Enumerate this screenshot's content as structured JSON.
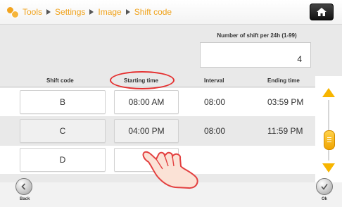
{
  "breadcrumb": {
    "items": [
      "Tools",
      "Settings",
      "Image",
      "Shift code"
    ]
  },
  "shifts_per_day": {
    "label": "Number of shift per 24h (1-99)",
    "value": "4"
  },
  "table": {
    "headers": {
      "shift_code": "Shift code",
      "starting_time": "Starting time",
      "interval": "Interval",
      "ending_time": "Ending time"
    },
    "rows": [
      {
        "code": "B",
        "start": "08:00 AM",
        "interval": "08:00",
        "end": "03:59 PM"
      },
      {
        "code": "C",
        "start": "04:00 PM",
        "interval": "08:00",
        "end": "11:59 PM"
      },
      {
        "code": "D",
        "start": "",
        "interval": "",
        "end": ""
      }
    ]
  },
  "footer": {
    "back_label": "Back",
    "ok_label": "Ok"
  },
  "icons": {
    "tools": "tools-icon",
    "home": "home-icon",
    "back": "back-arrow-icon",
    "ok": "checkmark-icon",
    "scroll_up": "triangle-up-icon",
    "scroll_down": "triangle-down-icon",
    "pointer": "hand-pointer-icon"
  },
  "colors": {
    "accent": "#f0a21a",
    "highlight": "#e53030"
  }
}
